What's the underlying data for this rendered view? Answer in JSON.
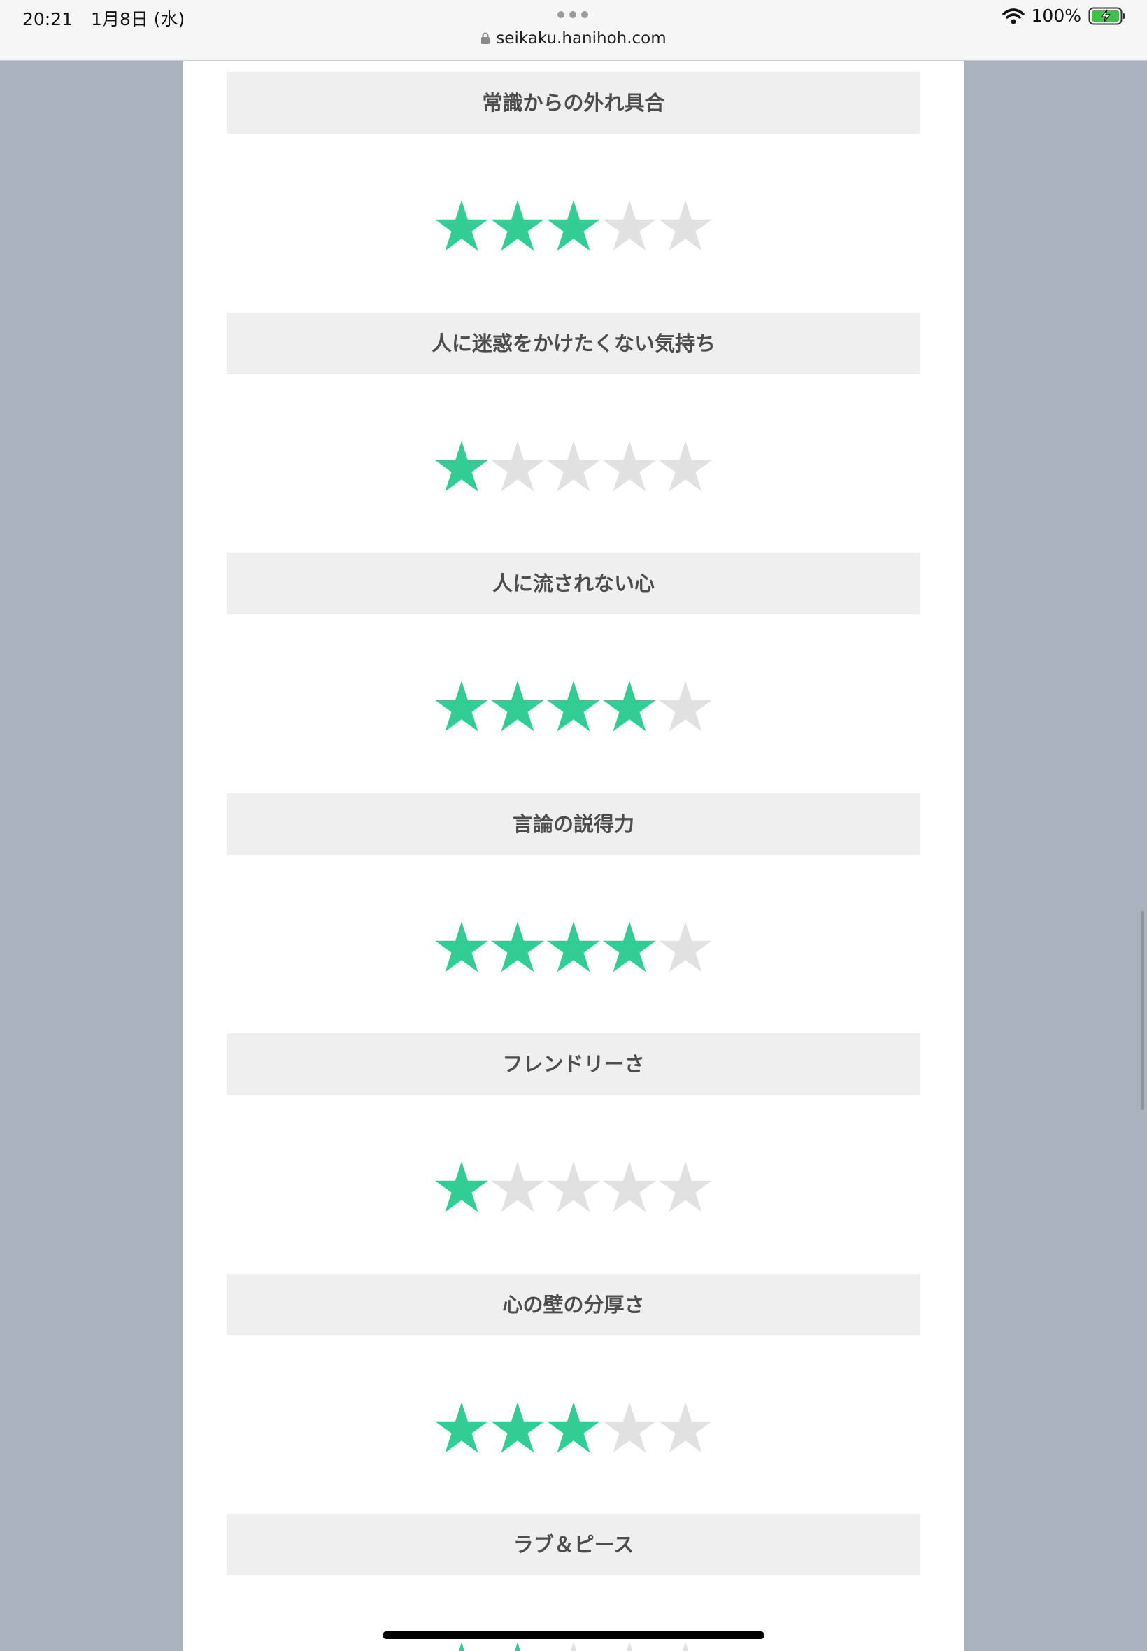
{
  "statusbar": {
    "time": "20:21",
    "date": "1月8日 (水)",
    "url": "seikaku.hanihoh.com",
    "battery": "100%",
    "icons": [
      "lock-icon",
      "wifi-icon",
      "battery-charging-icon"
    ]
  },
  "colors": {
    "star_filled": "#33cc93",
    "star_empty": "#e1e1e1",
    "header_bg": "#efefef",
    "side_bg": "#aab3bd"
  },
  "ratings": [
    {
      "label": "常識からの外れ具合",
      "stars": 3,
      "max": 5
    },
    {
      "label": "人に迷惑をかけたくない気持ち",
      "stars": 1,
      "max": 5
    },
    {
      "label": "人に流されない心",
      "stars": 4,
      "max": 5
    },
    {
      "label": "言論の説得力",
      "stars": 4,
      "max": 5
    },
    {
      "label": "フレンドリーさ",
      "stars": 1,
      "max": 5
    },
    {
      "label": "心の壁の分厚さ",
      "stars": 3,
      "max": 5
    },
    {
      "label": "ラブ＆ピース",
      "stars": 2,
      "max": 5
    }
  ]
}
